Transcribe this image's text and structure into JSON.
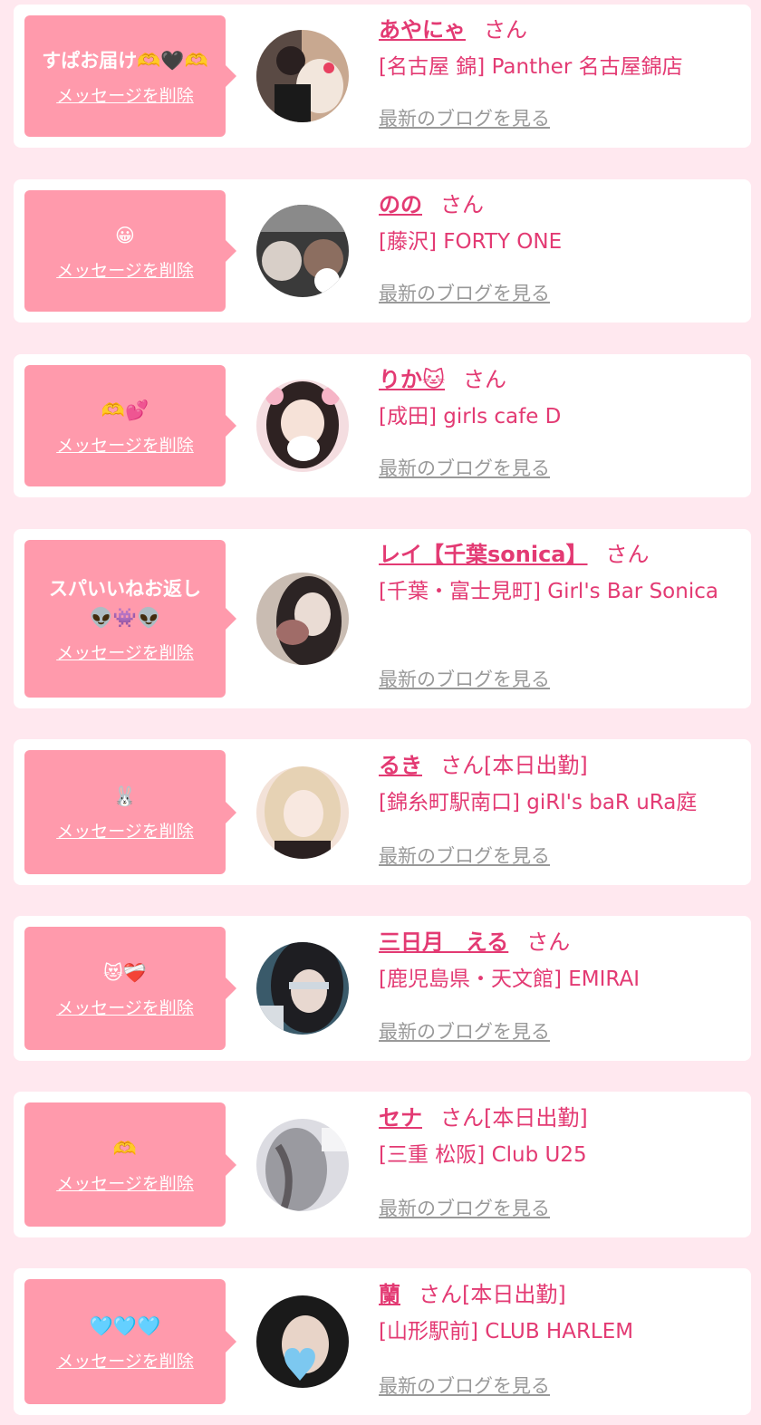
{
  "delete_label": "メッセージを削除",
  "blog_label": "最新のブログを見る",
  "san_label": "さん",
  "colors": {
    "accent": "#e33a73",
    "bubble": "#ff9aac",
    "background": "#ffe8ef",
    "card": "#ffffff",
    "link_gray": "#999999"
  },
  "messages": [
    {
      "message": "すぱお届け🫶🖤🫶",
      "name": "あやにゃ",
      "suffix": "",
      "shop": "[名古屋 錦] Panther 名古屋錦店",
      "avatar_colors": [
        "#5a4a44",
        "#f2e6dc",
        "#e84060"
      ]
    },
    {
      "message": "😀",
      "name": "のの",
      "suffix": "",
      "shop": "[藤沢] FORTY ONE",
      "avatar_colors": [
        "#3a3a3a",
        "#d8cfc8",
        "#8c6e60"
      ]
    },
    {
      "message": "🫶💕",
      "name": "りか🐱",
      "suffix": "",
      "shop": "[成田] girls cafe D",
      "avatar_colors": [
        "#2e2222",
        "#f4dde0",
        "#f6b4c6"
      ]
    },
    {
      "message": "スパいいねお返し\n👽👾👽",
      "name": "レイ【千葉sonica】",
      "suffix": "",
      "shop": "[千葉・富士見町] Girl's Bar Sonica",
      "avatar_colors": [
        "#c9bcb2",
        "#2c2424",
        "#a06c68"
      ]
    },
    {
      "message": "🐰",
      "name": "るき",
      "suffix": "[本日出勤]",
      "shop": "[錦糸町駅南口] giRl's baR uRa庭",
      "avatar_colors": [
        "#e6d2b4",
        "#f3e2d8",
        "#2a2020"
      ]
    },
    {
      "message": "😻❤️‍🩹",
      "name": "三日月　える",
      "suffix": "",
      "shop": "[鹿児島県・天文館] EMIRAI",
      "avatar_colors": [
        "#1e1e22",
        "#e8d8d0",
        "#3a5a6a"
      ]
    },
    {
      "message": "🫶",
      "name": "セナ",
      "suffix": "[本日出勤]",
      "shop": "[三重 松阪] Club U25",
      "avatar_colors": [
        "#9a9aa0",
        "#dcdce2",
        "#5e5a5e"
      ]
    },
    {
      "message": "🩵🩵🩵",
      "name": "蘭",
      "suffix": "[本日出勤]",
      "shop": "[山形駅前] CLUB HARLEM",
      "avatar_colors": [
        "#1a1a1a",
        "#e8d4c8",
        "#7cc8f0"
      ]
    }
  ]
}
